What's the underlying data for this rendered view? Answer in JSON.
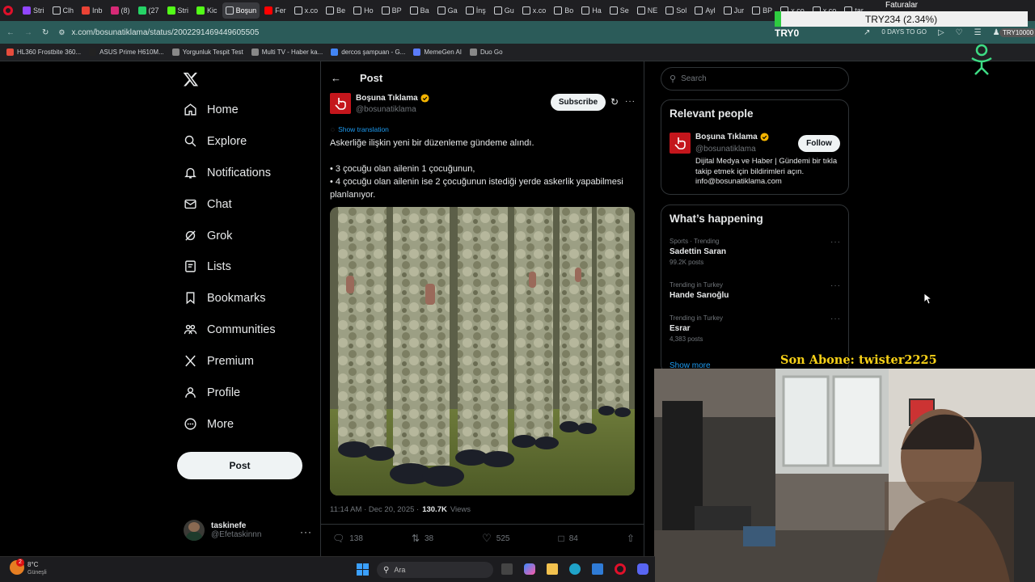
{
  "browser": {
    "tabs": [
      {
        "label": "Stri",
        "color": "#9146ff"
      },
      {
        "label": "Clh",
        "color": "#ffffff"
      },
      {
        "label": "Inb",
        "color": "#ea4335"
      },
      {
        "label": "(8)",
        "color": "#d62976"
      },
      {
        "label": "(27",
        "color": "#25d366"
      },
      {
        "label": "Stri",
        "color": "#53fc18"
      },
      {
        "label": "Kic",
        "color": "#53fc18"
      },
      {
        "label": "Boşun",
        "color": "#ffffff",
        "active": true
      },
      {
        "label": "Fer",
        "color": "#ff0000"
      },
      {
        "label": "x.co",
        "color": "#ffffff"
      },
      {
        "label": "Be",
        "color": "#ffffff"
      },
      {
        "label": "Ho",
        "color": "#ffffff"
      },
      {
        "label": "BP",
        "color": "#ffffff"
      },
      {
        "label": "Ba",
        "color": "#ffffff"
      },
      {
        "label": "Ga",
        "color": "#ffffff"
      },
      {
        "label": "İnş",
        "color": "#ffffff"
      },
      {
        "label": "Gu",
        "color": "#ffffff"
      },
      {
        "label": "x.co",
        "color": "#ffffff"
      },
      {
        "label": "Bo",
        "color": "#ffffff"
      },
      {
        "label": "Ha",
        "color": "#ffffff"
      },
      {
        "label": "Se",
        "color": "#ffffff"
      },
      {
        "label": "NE",
        "color": "#ffffff"
      },
      {
        "label": "Sol",
        "color": "#ffffff"
      },
      {
        "label": "Ayl",
        "color": "#ffffff"
      },
      {
        "label": "Jur",
        "color": "#ffffff"
      },
      {
        "label": "BP",
        "color": "#ffffff"
      },
      {
        "label": "x.co",
        "color": "#ffffff"
      },
      {
        "label": "x.co",
        "color": "#ffffff"
      },
      {
        "label": "tar",
        "color": "#ffffff"
      }
    ],
    "url": "x.com/bosunatiklama/status/2002291469449605505",
    "bookmarks": [
      {
        "label": "HL360 Frostbite 360...",
        "color": "#e74c3c"
      },
      {
        "label": "ASUS Prime H610M...",
        "color": "#222"
      },
      {
        "label": "Yorgunluk Tespit Test",
        "color": "#888"
      },
      {
        "label": "Multi TV - Haber ka...",
        "color": "#888"
      },
      {
        "label": "dercos şampuan - G...",
        "color": "#4285f4"
      },
      {
        "label": "MemeGen AI",
        "color": "#5b7cfa"
      },
      {
        "label": "Duo Go",
        "color": "#888"
      }
    ]
  },
  "stream_overlay": {
    "ticker": "TRY234 (2.34%)",
    "faturalar": "Faturalar",
    "try0": "TRY0",
    "days_to_go": "0 DAYS TO GO",
    "try10000": "TRY10000",
    "last_sub": "Son Abone: twister2225"
  },
  "nav": {
    "items": [
      {
        "label": "Home",
        "icon": "home-icon"
      },
      {
        "label": "Explore",
        "icon": "search-icon"
      },
      {
        "label": "Notifications",
        "icon": "bell-icon"
      },
      {
        "label": "Chat",
        "icon": "mail-icon"
      },
      {
        "label": "Grok",
        "icon": "grok-icon"
      },
      {
        "label": "Lists",
        "icon": "list-icon"
      },
      {
        "label": "Bookmarks",
        "icon": "bookmark-icon"
      },
      {
        "label": "Communities",
        "icon": "communities-icon"
      },
      {
        "label": "Premium",
        "icon": "x-logo-icon"
      },
      {
        "label": "Profile",
        "icon": "person-icon"
      },
      {
        "label": "More",
        "icon": "more-circle-icon"
      }
    ],
    "post_button": "Post",
    "account": {
      "name": "taskinefe",
      "handle": "@Efetaskinnn"
    }
  },
  "post": {
    "header": "Post",
    "author": {
      "name": "Boşuna Tıklama",
      "handle": "@bosunatiklama"
    },
    "subscribe": "Subscribe",
    "show_translation": "Show translation",
    "text_line1": "Askerliğe ilişkin yeni bir düzenleme gündeme alındı.",
    "bullet1": "• 3 çocuğu olan ailenin 1 çocuğunun,",
    "bullet2": "• 4 çocuğu olan ailenin ise 2 çocuğunun istediği yerde askerlik yapabilmesi planlanıyor.",
    "time": "11:14 AM · Dec 20, 2025 ·",
    "views_count": "130.7K",
    "views_label": "Views",
    "replies": "138",
    "reposts": "38",
    "likes": "525",
    "bookmarks": "84"
  },
  "sidebar": {
    "search_placeholder": "Search",
    "relevant_title": "Relevant people",
    "person": {
      "name": "Boşuna Tıklama",
      "handle": "@bosunatiklama",
      "follow": "Follow",
      "bio": "Dijital Medya ve Haber | Gündemi bir tıkla takip etmek için bildirimleri açın. info@bosunatiklama.com"
    },
    "happening_title": "What’s happening",
    "trends": [
      {
        "meta": "Sports · Trending",
        "name": "Sadettin Saran",
        "posts": "99.2K posts"
      },
      {
        "meta": "Trending in Turkey",
        "name": "Hande Sarıoğlu",
        "posts": ""
      },
      {
        "meta": "Trending in Turkey",
        "name": "Esrar",
        "posts": "4,383 posts"
      }
    ],
    "show_more": "Show more"
  },
  "taskbar": {
    "weather_temp": "8°C",
    "weather_desc": "Güneşli",
    "search_placeholder": "Ara"
  },
  "colors": {
    "verified": "#f4b400",
    "brand_red": "#c4161c",
    "link": "#1d9bf0",
    "address_bar": "#2b5b59",
    "overlay_yellow": "#f7d117"
  }
}
